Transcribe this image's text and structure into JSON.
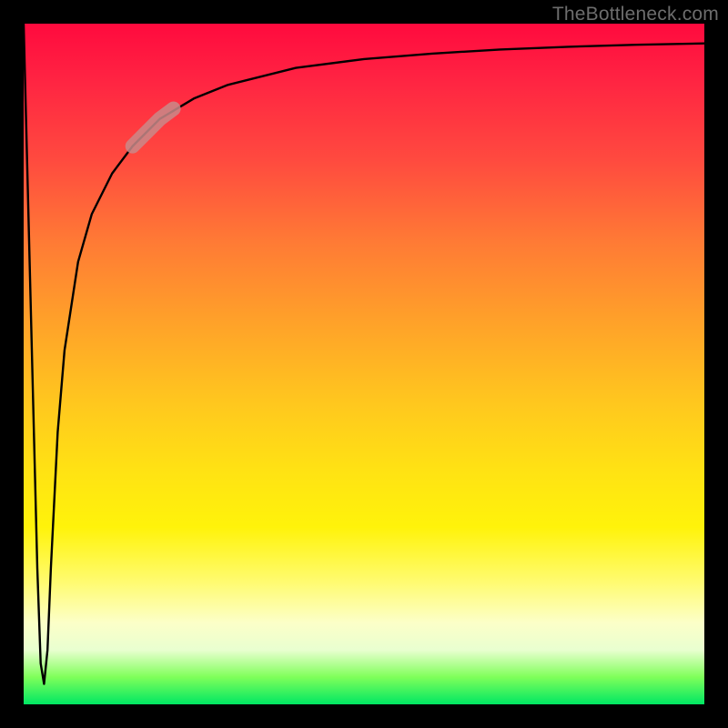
{
  "watermark": "TheBottleneck.com",
  "chart_data": {
    "type": "line",
    "title": "",
    "xlabel": "",
    "ylabel": "",
    "xlim": [
      0,
      100
    ],
    "ylim": [
      0,
      100
    ],
    "grid": false,
    "legend": false,
    "background_gradient": {
      "direction": "vertical",
      "stops": [
        {
          "pos": 0.0,
          "color": "#ff0a3e"
        },
        {
          "pos": 0.5,
          "color": "#ffc81e"
        },
        {
          "pos": 0.8,
          "color": "#fff30a"
        },
        {
          "pos": 0.95,
          "color": "#7fff5a"
        },
        {
          "pos": 1.0,
          "color": "#00e763"
        }
      ]
    },
    "series": [
      {
        "name": "bottleneck-curve",
        "color": "#000000",
        "x": [
          0.0,
          1.0,
          2.0,
          2.5,
          3.0,
          3.5,
          4.0,
          5.0,
          6.0,
          8.0,
          10.0,
          13.0,
          16.0,
          20.0,
          25.0,
          30.0,
          40.0,
          50.0,
          60.0,
          70.0,
          80.0,
          90.0,
          100.0
        ],
        "y": [
          100.0,
          60.0,
          20.0,
          6.0,
          3.0,
          8.0,
          20.0,
          40.0,
          52.0,
          65.0,
          72.0,
          78.0,
          82.0,
          86.0,
          89.0,
          91.0,
          93.5,
          94.8,
          95.6,
          96.2,
          96.6,
          96.9,
          97.1
        ]
      }
    ],
    "highlight_segment": {
      "series": "bottleneck-curve",
      "x_start": 16.0,
      "x_end": 22.0,
      "color": "#c98a8a",
      "width": 16
    },
    "annotations": []
  }
}
